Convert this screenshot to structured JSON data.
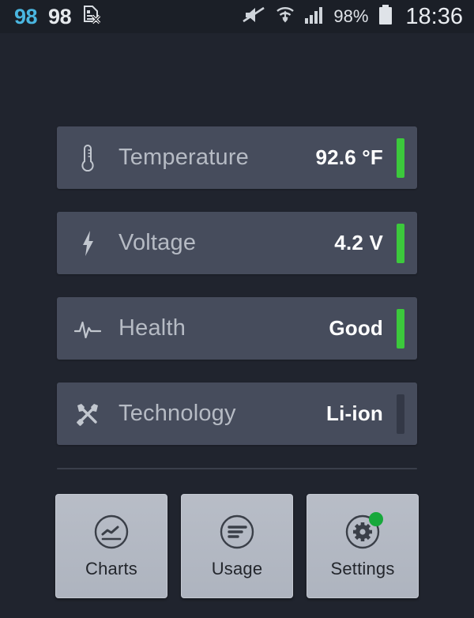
{
  "statusbar": {
    "left_items": [
      {
        "name": "battery-level-accent",
        "text": "98",
        "color": "#4ab6e0"
      },
      {
        "name": "battery-level-plain",
        "text": "98",
        "color": "#e6e9ed"
      },
      {
        "name": "sim-card-off-icon",
        "text": ""
      }
    ],
    "icons": {
      "mute": "mute-icon",
      "wifi": "wifi-icon",
      "signal": "signal-icon",
      "battery": "battery-icon"
    },
    "battery_percent": "98%",
    "time": "18:36"
  },
  "cards": [
    {
      "icon": "thermometer-icon",
      "label": "Temperature",
      "value": "92.6 °F",
      "bar_color": "#3cc93c",
      "bar_state": "active"
    },
    {
      "icon": "lightning-bolt-icon",
      "label": "Voltage",
      "value": "4.2 V",
      "bar_color": "#3cc93c",
      "bar_state": "active"
    },
    {
      "icon": "pulse-icon",
      "label": "Health",
      "value": "Good",
      "bar_color": "#3cc93c",
      "bar_state": "active"
    },
    {
      "icon": "tools-icon",
      "label": "Technology",
      "value": "Li-ion",
      "bar_color": "#333846",
      "bar_state": "inactive"
    }
  ],
  "buttons": [
    {
      "icon": "chart-circle-icon",
      "label": "Charts",
      "badge": false
    },
    {
      "icon": "usage-bars-circle-icon",
      "label": "Usage",
      "badge": false
    },
    {
      "icon": "gear-circle-icon",
      "label": "Settings",
      "badge": true,
      "badge_color": "#17a83b"
    }
  ],
  "theme": {
    "background": "#20242e",
    "statusbar_bg": "#1b1f27",
    "card_bg": "#464c5c",
    "label_color": "#b6bbc4",
    "value_color": "#ffffff",
    "accent_green": "#3cc93c",
    "button_bg": "#b3b9c3"
  }
}
